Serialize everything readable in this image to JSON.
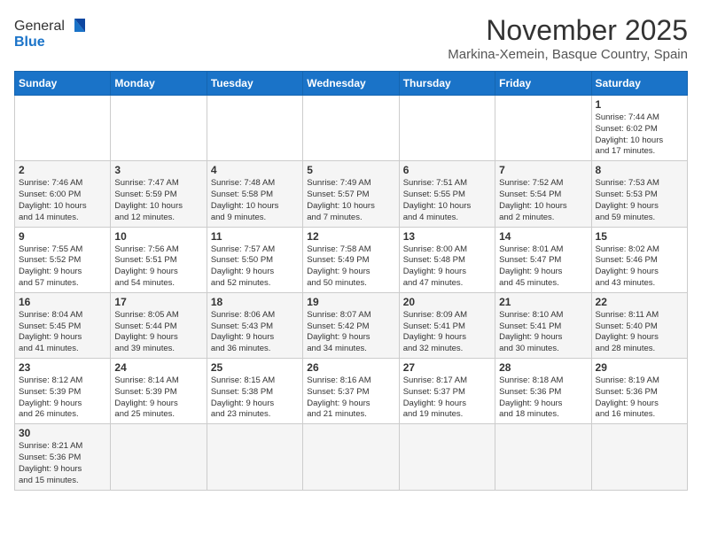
{
  "header": {
    "logo_line1": "General",
    "logo_line2": "Blue",
    "month_title": "November 2025",
    "subtitle": "Markina-Xemein, Basque Country, Spain"
  },
  "weekdays": [
    "Sunday",
    "Monday",
    "Tuesday",
    "Wednesday",
    "Thursday",
    "Friday",
    "Saturday"
  ],
  "weeks": [
    [
      {
        "day": "",
        "info": ""
      },
      {
        "day": "",
        "info": ""
      },
      {
        "day": "",
        "info": ""
      },
      {
        "day": "",
        "info": ""
      },
      {
        "day": "",
        "info": ""
      },
      {
        "day": "",
        "info": ""
      },
      {
        "day": "1",
        "info": "Sunrise: 7:44 AM\nSunset: 6:02 PM\nDaylight: 10 hours\nand 17 minutes."
      }
    ],
    [
      {
        "day": "2",
        "info": "Sunrise: 7:46 AM\nSunset: 6:00 PM\nDaylight: 10 hours\nand 14 minutes."
      },
      {
        "day": "3",
        "info": "Sunrise: 7:47 AM\nSunset: 5:59 PM\nDaylight: 10 hours\nand 12 minutes."
      },
      {
        "day": "4",
        "info": "Sunrise: 7:48 AM\nSunset: 5:58 PM\nDaylight: 10 hours\nand 9 minutes."
      },
      {
        "day": "5",
        "info": "Sunrise: 7:49 AM\nSunset: 5:57 PM\nDaylight: 10 hours\nand 7 minutes."
      },
      {
        "day": "6",
        "info": "Sunrise: 7:51 AM\nSunset: 5:55 PM\nDaylight: 10 hours\nand 4 minutes."
      },
      {
        "day": "7",
        "info": "Sunrise: 7:52 AM\nSunset: 5:54 PM\nDaylight: 10 hours\nand 2 minutes."
      },
      {
        "day": "8",
        "info": "Sunrise: 7:53 AM\nSunset: 5:53 PM\nDaylight: 9 hours\nand 59 minutes."
      }
    ],
    [
      {
        "day": "9",
        "info": "Sunrise: 7:55 AM\nSunset: 5:52 PM\nDaylight: 9 hours\nand 57 minutes."
      },
      {
        "day": "10",
        "info": "Sunrise: 7:56 AM\nSunset: 5:51 PM\nDaylight: 9 hours\nand 54 minutes."
      },
      {
        "day": "11",
        "info": "Sunrise: 7:57 AM\nSunset: 5:50 PM\nDaylight: 9 hours\nand 52 minutes."
      },
      {
        "day": "12",
        "info": "Sunrise: 7:58 AM\nSunset: 5:49 PM\nDaylight: 9 hours\nand 50 minutes."
      },
      {
        "day": "13",
        "info": "Sunrise: 8:00 AM\nSunset: 5:48 PM\nDaylight: 9 hours\nand 47 minutes."
      },
      {
        "day": "14",
        "info": "Sunrise: 8:01 AM\nSunset: 5:47 PM\nDaylight: 9 hours\nand 45 minutes."
      },
      {
        "day": "15",
        "info": "Sunrise: 8:02 AM\nSunset: 5:46 PM\nDaylight: 9 hours\nand 43 minutes."
      }
    ],
    [
      {
        "day": "16",
        "info": "Sunrise: 8:04 AM\nSunset: 5:45 PM\nDaylight: 9 hours\nand 41 minutes."
      },
      {
        "day": "17",
        "info": "Sunrise: 8:05 AM\nSunset: 5:44 PM\nDaylight: 9 hours\nand 39 minutes."
      },
      {
        "day": "18",
        "info": "Sunrise: 8:06 AM\nSunset: 5:43 PM\nDaylight: 9 hours\nand 36 minutes."
      },
      {
        "day": "19",
        "info": "Sunrise: 8:07 AM\nSunset: 5:42 PM\nDaylight: 9 hours\nand 34 minutes."
      },
      {
        "day": "20",
        "info": "Sunrise: 8:09 AM\nSunset: 5:41 PM\nDaylight: 9 hours\nand 32 minutes."
      },
      {
        "day": "21",
        "info": "Sunrise: 8:10 AM\nSunset: 5:41 PM\nDaylight: 9 hours\nand 30 minutes."
      },
      {
        "day": "22",
        "info": "Sunrise: 8:11 AM\nSunset: 5:40 PM\nDaylight: 9 hours\nand 28 minutes."
      }
    ],
    [
      {
        "day": "23",
        "info": "Sunrise: 8:12 AM\nSunset: 5:39 PM\nDaylight: 9 hours\nand 26 minutes."
      },
      {
        "day": "24",
        "info": "Sunrise: 8:14 AM\nSunset: 5:39 PM\nDaylight: 9 hours\nand 25 minutes."
      },
      {
        "day": "25",
        "info": "Sunrise: 8:15 AM\nSunset: 5:38 PM\nDaylight: 9 hours\nand 23 minutes."
      },
      {
        "day": "26",
        "info": "Sunrise: 8:16 AM\nSunset: 5:37 PM\nDaylight: 9 hours\nand 21 minutes."
      },
      {
        "day": "27",
        "info": "Sunrise: 8:17 AM\nSunset: 5:37 PM\nDaylight: 9 hours\nand 19 minutes."
      },
      {
        "day": "28",
        "info": "Sunrise: 8:18 AM\nSunset: 5:36 PM\nDaylight: 9 hours\nand 18 minutes."
      },
      {
        "day": "29",
        "info": "Sunrise: 8:19 AM\nSunset: 5:36 PM\nDaylight: 9 hours\nand 16 minutes."
      }
    ],
    [
      {
        "day": "30",
        "info": "Sunrise: 8:21 AM\nSunset: 5:36 PM\nDaylight: 9 hours\nand 15 minutes."
      },
      {
        "day": "",
        "info": ""
      },
      {
        "day": "",
        "info": ""
      },
      {
        "day": "",
        "info": ""
      },
      {
        "day": "",
        "info": ""
      },
      {
        "day": "",
        "info": ""
      },
      {
        "day": "",
        "info": ""
      }
    ]
  ]
}
